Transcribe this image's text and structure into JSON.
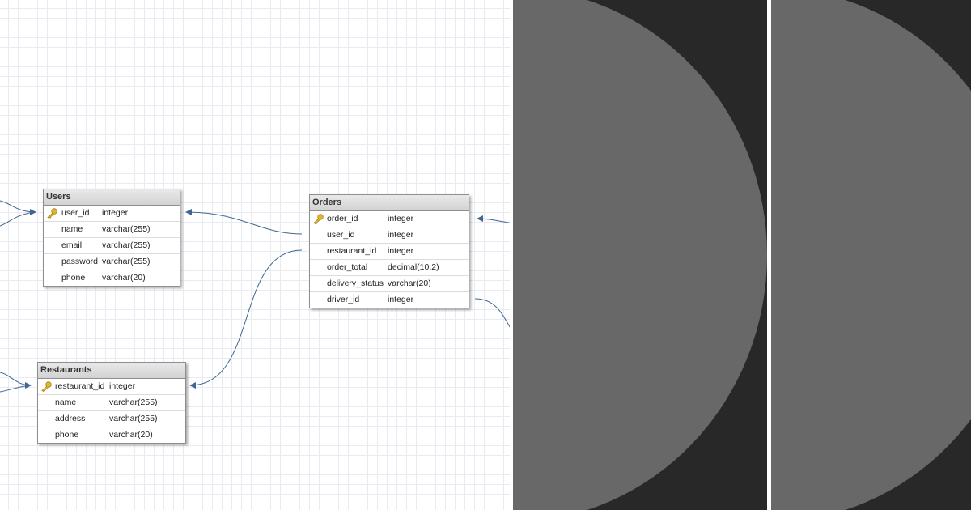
{
  "diagram": {
    "tables": [
      {
        "id": "users",
        "title": "Users",
        "columns": [
          {
            "name": "user_id",
            "type": "integer",
            "pk": true
          },
          {
            "name": "name",
            "type": "varchar(255)"
          },
          {
            "name": "email",
            "type": "varchar(255)"
          },
          {
            "name": "password",
            "type": "varchar(255)"
          },
          {
            "name": "phone",
            "type": "varchar(20)"
          }
        ]
      },
      {
        "id": "orders",
        "title": "Orders",
        "columns": [
          {
            "name": "order_id",
            "type": "integer",
            "pk": true
          },
          {
            "name": "user_id",
            "type": "integer"
          },
          {
            "name": "restaurant_id",
            "type": "integer"
          },
          {
            "name": "order_total",
            "type": "decimal(10,2)"
          },
          {
            "name": "delivery_status",
            "type": "varchar(20)"
          },
          {
            "name": "driver_id",
            "type": "integer"
          }
        ]
      },
      {
        "id": "restaurants",
        "title": "Restaurants",
        "columns": [
          {
            "name": "restaurant_id",
            "type": "integer",
            "pk": true
          },
          {
            "name": "name",
            "type": "varchar(255)"
          },
          {
            "name": "address",
            "type": "varchar(255)"
          },
          {
            "name": "phone",
            "type": "varchar(20)"
          }
        ]
      }
    ],
    "relationships": [
      {
        "from": "orders.user_id",
        "to": "users.user_id"
      },
      {
        "from": "orders.restaurant_id",
        "to": "restaurants.restaurant_id"
      }
    ]
  },
  "colors": {
    "grid_line": "#e8ecf2",
    "link": "#3f6791",
    "panel_background": "#282828",
    "circle": "#686868",
    "key_icon": "#e6b52a"
  },
  "icons": {
    "primary_key": "key-icon"
  }
}
